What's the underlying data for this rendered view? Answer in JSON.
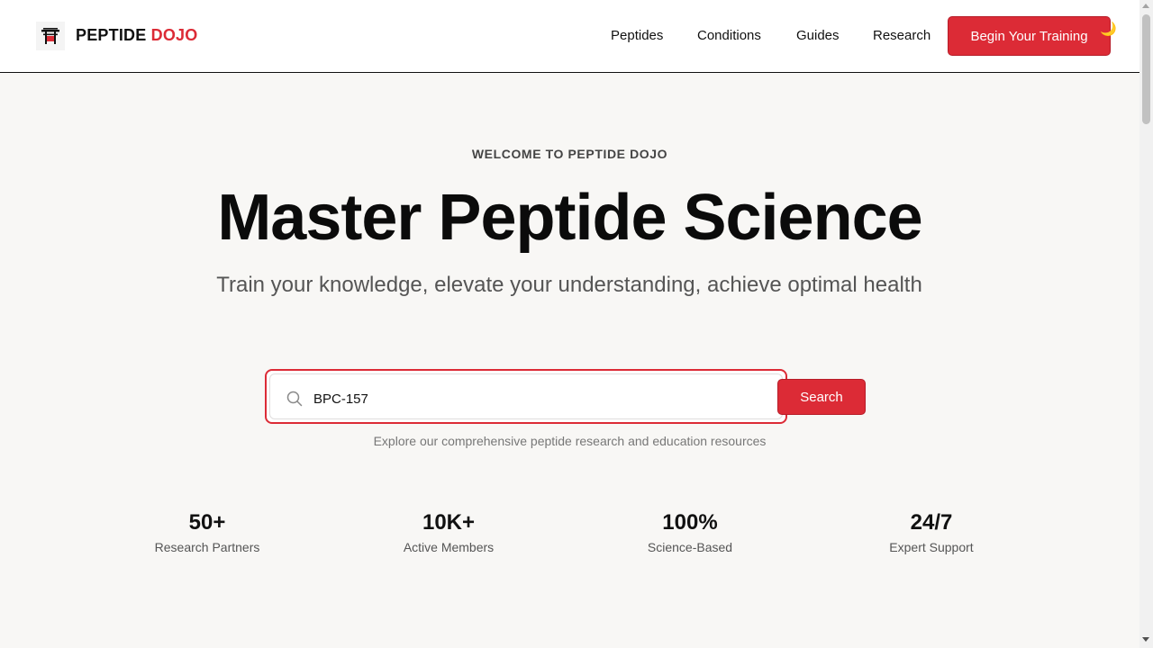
{
  "header": {
    "brand_main": "PEPTIDE",
    "brand_accent": "DOJO",
    "nav": [
      "Peptides",
      "Conditions",
      "Guides",
      "Research"
    ],
    "cta_label": "Begin Your Training",
    "logo_icon": "torii-gate-icon",
    "theme_icon": "moon-icon"
  },
  "hero": {
    "eyebrow": "WELCOME TO PEPTIDE DOJO",
    "title": "Master Peptide Science",
    "subtitle": "Train your knowledge, elevate your understanding, achieve optimal health"
  },
  "search": {
    "value": "BPC-157",
    "button_label": "Search",
    "hint": "Explore our comprehensive peptide research and education resources"
  },
  "stats": [
    {
      "value": "50+",
      "label": "Research Partners"
    },
    {
      "value": "10K+",
      "label": "Active Members"
    },
    {
      "value": "100%",
      "label": "Science-Based"
    },
    {
      "value": "24/7",
      "label": "Expert Support"
    }
  ],
  "colors": {
    "accent": "#dc2b36",
    "background": "#f8f7f5",
    "header_bg": "#ffffff"
  }
}
